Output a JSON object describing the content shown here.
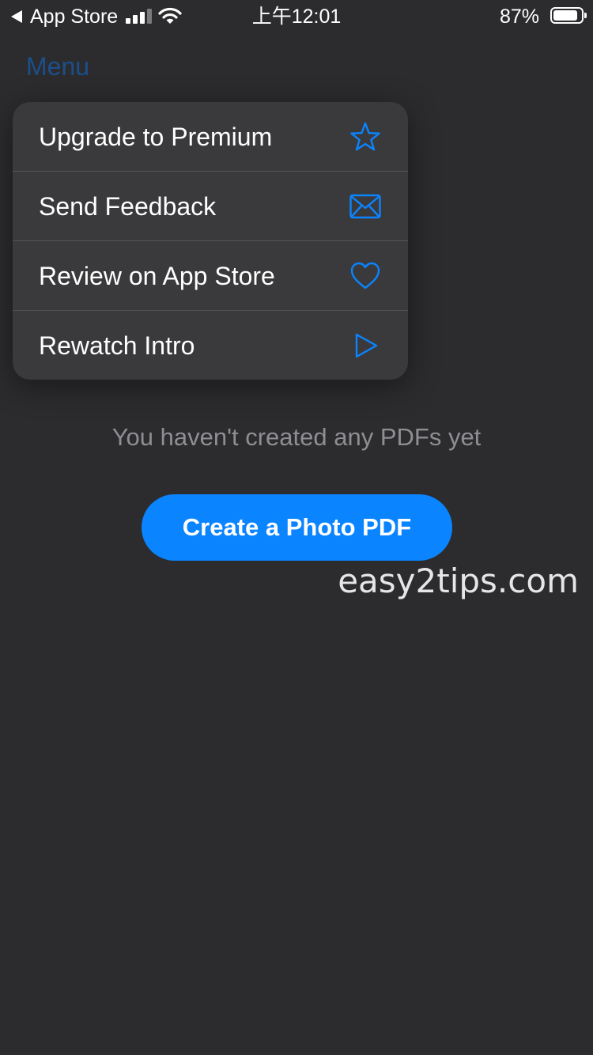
{
  "status_bar": {
    "back_app": "App Store",
    "time": "上午12:01",
    "battery_percent": "87%",
    "battery_level": 0.87,
    "signal_bars_active": 3,
    "signal_bars_total": 4
  },
  "nav": {
    "title": "Menu"
  },
  "menu": {
    "items": [
      {
        "label": "Upgrade to Premium",
        "icon": "star-icon"
      },
      {
        "label": "Send Feedback",
        "icon": "envelope-icon"
      },
      {
        "label": "Review on App Store",
        "icon": "heart-icon"
      },
      {
        "label": "Rewatch Intro",
        "icon": "play-icon"
      }
    ]
  },
  "empty_state": {
    "message": "You haven't created any PDFs yet",
    "button_label": "Create a Photo PDF"
  },
  "watermark": "easy2tips.com",
  "colors": {
    "accent": "#0a84ff",
    "background": "#2c2c2e",
    "popup": "#3a3a3c"
  }
}
